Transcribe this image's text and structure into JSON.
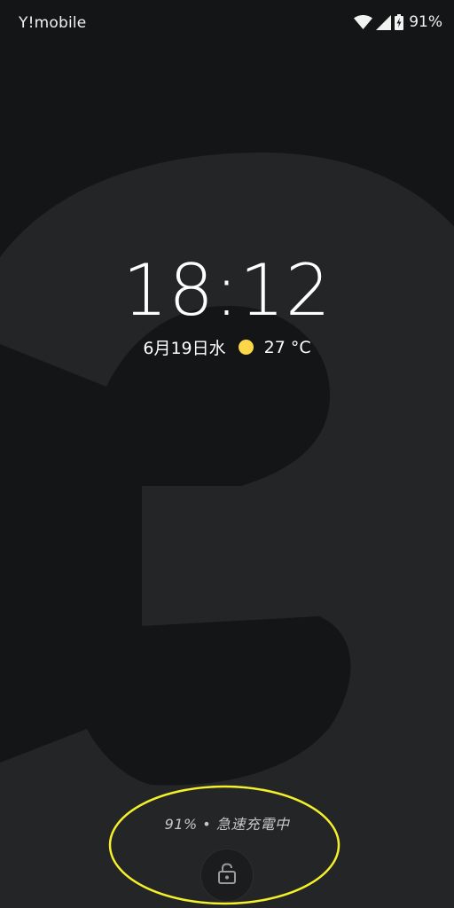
{
  "status_bar": {
    "carrier": "Y!mobile",
    "battery_percent": "91%",
    "icons": [
      "wifi-icon",
      "cell-signal-icon",
      "battery-charging-icon"
    ]
  },
  "lock_screen": {
    "time": "18:12",
    "date": "6月19日水",
    "weather_icon": "sun-icon",
    "temperature": "27 °C",
    "charging_status": "91% • 急速充電中",
    "unlock_icon": "unlock-icon"
  },
  "colors": {
    "background": "#141516",
    "wallpaper_numeral": "#232527",
    "sun": "#fdd649",
    "highlight": "#f4f02a"
  }
}
